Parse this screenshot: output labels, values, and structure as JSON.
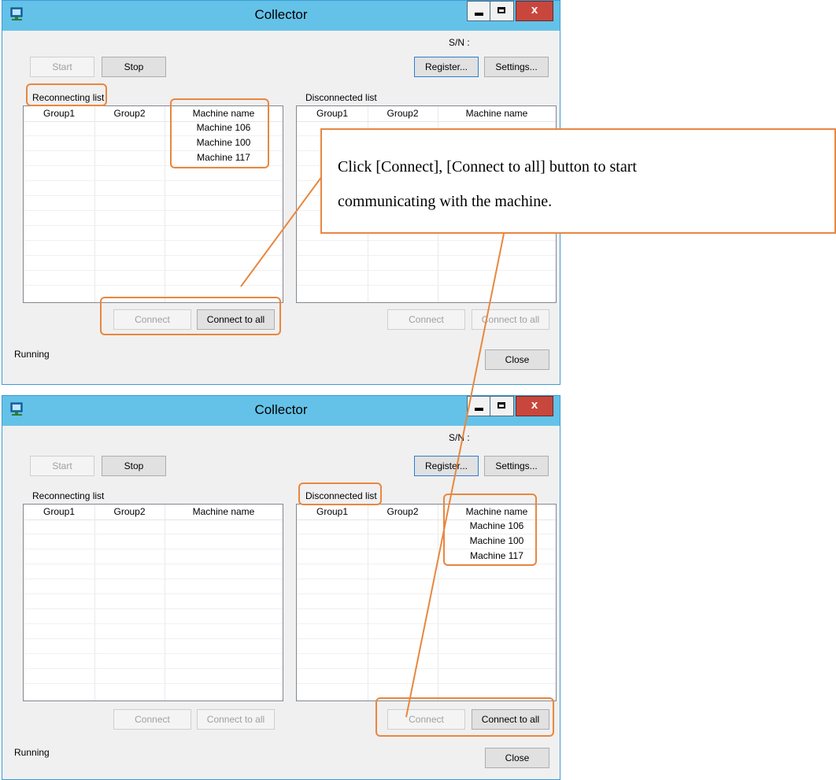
{
  "windows": [
    {
      "title": "Collector",
      "sn_label": "S/N :",
      "buttons": {
        "start": "Start",
        "stop": "Stop",
        "register": "Register...",
        "settings": "Settings...",
        "connect": "Connect",
        "connect_all": "Connect to all",
        "close": "Close"
      },
      "reconnecting": {
        "label": "Reconnecting list",
        "columns": [
          "Group1",
          "Group2",
          "Machine name"
        ],
        "rows": [
          "Machine 106",
          "Machine 100",
          "Machine 117"
        ]
      },
      "disconnected": {
        "label": "Disconnected list",
        "columns": [
          "Group1",
          "Group2",
          "Machine name"
        ],
        "rows": []
      },
      "status": "Running"
    },
    {
      "title": "Collector",
      "sn_label": "S/N :",
      "buttons": {
        "start": "Start",
        "stop": "Stop",
        "register": "Register...",
        "settings": "Settings...",
        "connect": "Connect",
        "connect_all": "Connect to all",
        "close": "Close"
      },
      "reconnecting": {
        "label": "Reconnecting list",
        "columns": [
          "Group1",
          "Group2",
          "Machine name"
        ],
        "rows": []
      },
      "disconnected": {
        "label": "Disconnected list",
        "columns": [
          "Group1",
          "Group2",
          "Machine name"
        ],
        "rows": [
          "Machine 106",
          "Machine 100",
          "Machine 117"
        ]
      },
      "status": "Running"
    }
  ],
  "callout": {
    "line1": "Click [Connect], [Connect to all] button to start",
    "line2": "communicating with the machine."
  },
  "colors": {
    "titlebar": "#64c2e8",
    "highlight": "#e8873f",
    "close_button": "#c8473d"
  }
}
